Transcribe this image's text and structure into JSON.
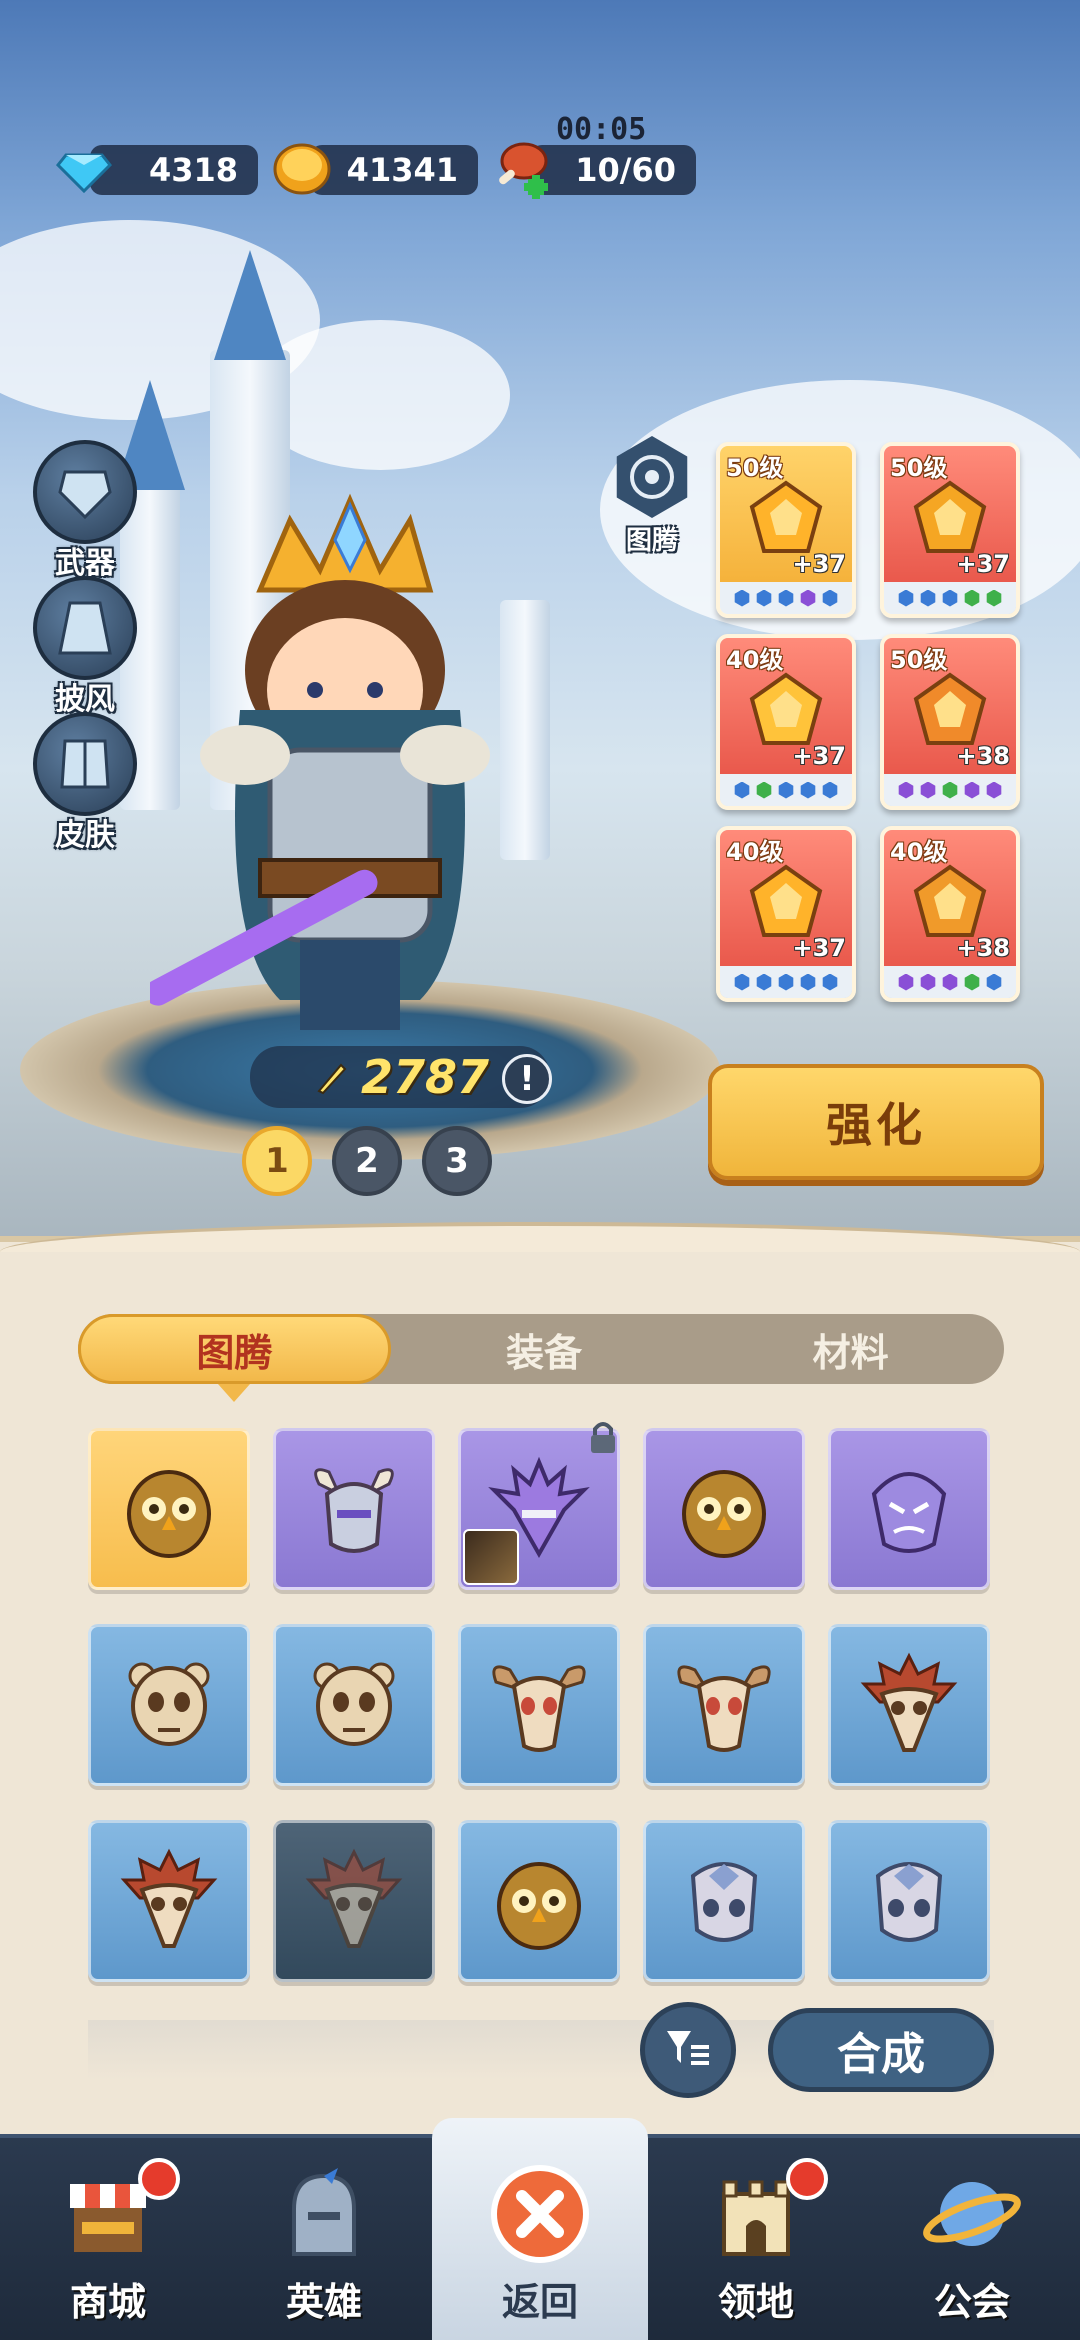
{
  "resources": {
    "gems": "4318",
    "coins": "41341",
    "stamina": "10/60",
    "stamina_timer": "00:05",
    "icons": [
      "diamond-icon",
      "coin-icon",
      "meat-icon"
    ]
  },
  "side_menu": [
    {
      "label": "武器",
      "icon": "armor-icon"
    },
    {
      "label": "披风",
      "icon": "cape-icon"
    },
    {
      "label": "皮肤",
      "icon": "skin-icon"
    }
  ],
  "totem_button": {
    "label": "图腾",
    "icon": "totem-icon"
  },
  "equipment": [
    {
      "level": "50级",
      "bonus": "+37",
      "style": "gold",
      "slots": [
        "#3a7bd5",
        "#3a7bd5",
        "#3a7bd5",
        "#8a4fd6",
        "#3a7bd5"
      ]
    },
    {
      "level": "50级",
      "bonus": "+37",
      "style": "red",
      "slots": [
        "#3a7bd5",
        "#3a7bd5",
        "#3a7bd5",
        "#3fb04a",
        "#3fb04a"
      ]
    },
    {
      "level": "40级",
      "bonus": "+37",
      "style": "red",
      "slots": [
        "#3a7bd5",
        "#3fb04a",
        "#3a7bd5",
        "#3a7bd5",
        "#3a7bd5"
      ]
    },
    {
      "level": "50级",
      "bonus": "+38",
      "style": "red",
      "slots": [
        "#8a4fd6",
        "#8a4fd6",
        "#3fb04a",
        "#8a4fd6",
        "#8a4fd6"
      ]
    },
    {
      "level": "40级",
      "bonus": "+37",
      "style": "red",
      "slots": [
        "#3a7bd5",
        "#3a7bd5",
        "#3a7bd5",
        "#3a7bd5",
        "#3a7bd5"
      ]
    },
    {
      "level": "40级",
      "bonus": "+38",
      "style": "red",
      "slots": [
        "#8a4fd6",
        "#8a4fd6",
        "#8a4fd6",
        "#3fb04a",
        "#3a7bd5"
      ]
    }
  ],
  "power": {
    "value": "2787",
    "info": "!"
  },
  "pages": [
    "1",
    "2",
    "3"
  ],
  "active_page": "1",
  "strengthen_label": "强化",
  "tabs": [
    {
      "label": "图腾",
      "active": true
    },
    {
      "label": "装备",
      "active": false
    },
    {
      "label": "材料",
      "active": false
    }
  ],
  "totems": [
    {
      "kind": "owl",
      "bg": "gold"
    },
    {
      "kind": "horned-helm",
      "bg": "purple"
    },
    {
      "kind": "spiked-helm",
      "bg": "purple",
      "locked": true,
      "equipped": true
    },
    {
      "kind": "owl",
      "bg": "purple"
    },
    {
      "kind": "beast-helm",
      "bg": "purple"
    },
    {
      "kind": "bear-skull",
      "bg": "blue"
    },
    {
      "kind": "bear-skull",
      "bg": "blue"
    },
    {
      "kind": "bull-skull",
      "bg": "blue"
    },
    {
      "kind": "bull-skull",
      "bg": "blue"
    },
    {
      "kind": "bird-skull",
      "bg": "blue"
    },
    {
      "kind": "bird-skull",
      "bg": "blue"
    },
    {
      "kind": "bird-skull",
      "bg": "dark"
    },
    {
      "kind": "owl",
      "bg": "blue"
    },
    {
      "kind": "beast-skull",
      "bg": "blue"
    },
    {
      "kind": "beast-skull",
      "bg": "blue"
    }
  ],
  "combine_label": "合成",
  "nav": [
    {
      "label": "商城",
      "icon": "shop-icon",
      "badge": true
    },
    {
      "label": "英雄",
      "icon": "helmet-icon",
      "badge": false
    },
    {
      "label": "返回",
      "icon": "close-icon",
      "badge": false,
      "active": true
    },
    {
      "label": "领地",
      "icon": "castle-icon",
      "badge": true
    },
    {
      "label": "公会",
      "icon": "planet-icon",
      "badge": false
    }
  ]
}
